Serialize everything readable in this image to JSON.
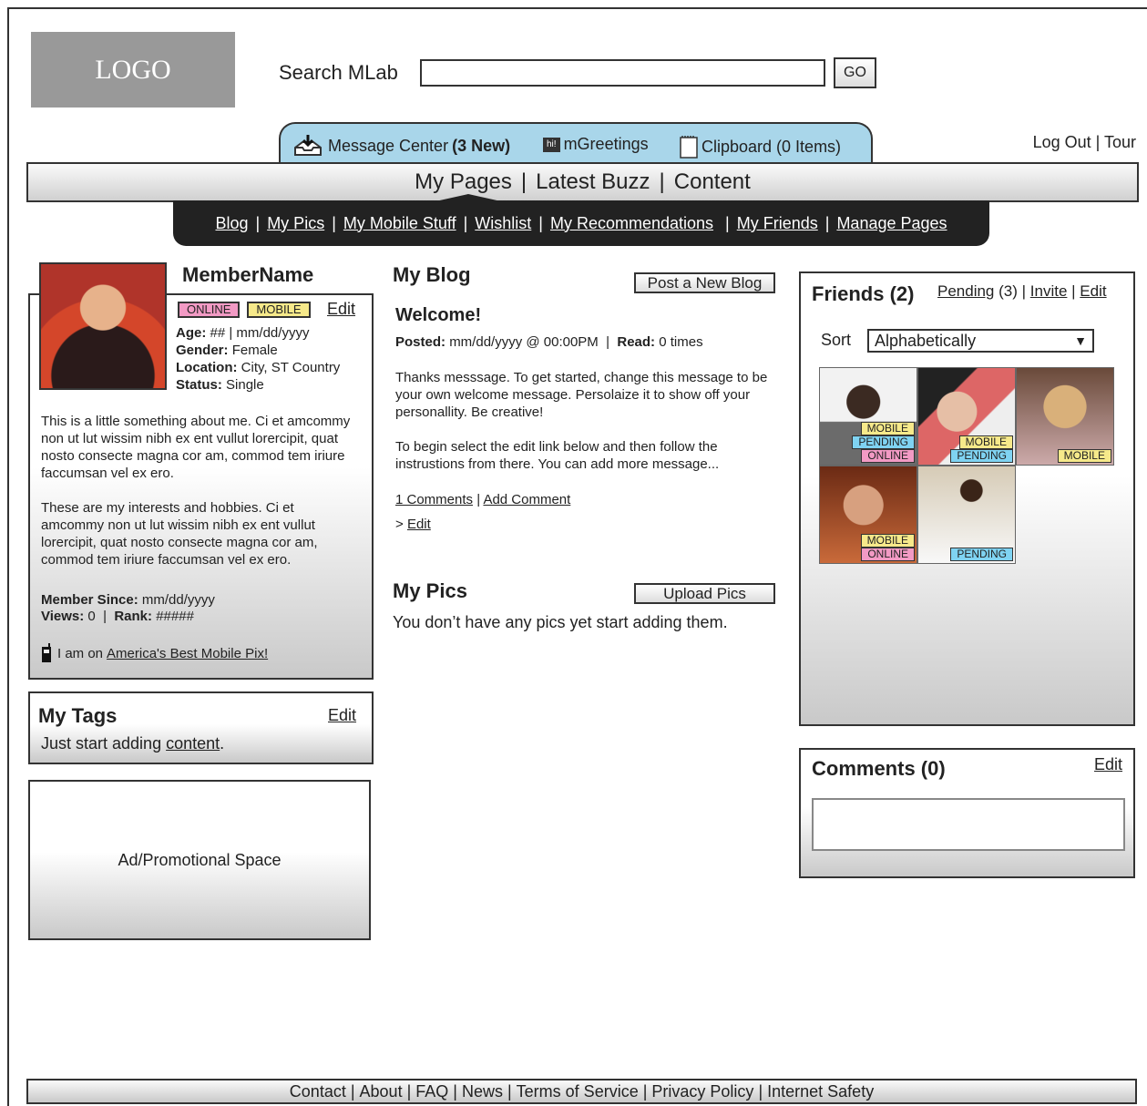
{
  "header": {
    "logo": "LOGO",
    "search_label": "Search MLab",
    "search_value": "",
    "go": "GO"
  },
  "utility": {
    "message_center": "Message Center",
    "message_new": "(3 New)",
    "mgreetings": "mGreetings",
    "mgreetings_icon_text": "hi!",
    "clipboard": "Clipboard (0 Items)",
    "logout": "Log Out",
    "tour": "Tour"
  },
  "mainnav": {
    "items": [
      "My Pages",
      "Latest Buzz",
      "Content"
    ]
  },
  "subnav": {
    "items": [
      "Blog",
      "My Pics",
      "My Mobile Stuff",
      "Wishlist",
      "My Recommendations",
      "My Friends",
      "Manage Pages"
    ]
  },
  "profile": {
    "name": "MemberName",
    "online": "ONLINE",
    "mobile": "MOBILE",
    "edit": "Edit",
    "age_label": "Age:",
    "age_value": "## | mm/dd/yyyy",
    "gender_label": "Gender:",
    "gender_value": "Female",
    "location_label": "Location:",
    "location_value": "City, ST Country",
    "status_label": "Status:",
    "status_value": "Single",
    "about1": "This is a little something about me. Ci et amcommy non ut lut wissim nibh ex ent vullut lorercipit, quat nosto consecte magna cor am, commod tem iriure faccumsan vel ex ero.",
    "about2": "These are my interests and hobbies. Ci et amcommy non ut lut wissim nibh ex ent vullut lorercipit, quat nosto consecte magna cor am, commod tem iriure faccumsan vel ex ero.",
    "member_since_label": "Member Since:",
    "member_since_value": "mm/dd/yyyy",
    "views_label": "Views:",
    "views_value": "0",
    "rank_label": "Rank:",
    "rank_value": "#####",
    "mobile_note": "I am on",
    "mobile_link": "America's Best Mobile Pix!"
  },
  "tags": {
    "title": "My Tags",
    "edit": "Edit",
    "text": "Just start adding",
    "link": "content",
    "period": "."
  },
  "ad": {
    "text": "Ad/Promotional Space"
  },
  "blog": {
    "title": "My Blog",
    "post_button": "Post a New Blog",
    "post_title": "Welcome!",
    "posted_label": "Posted:",
    "posted_value": "mm/dd/yyyy @ 00:00PM",
    "read_label": "Read:",
    "read_value": "0 times",
    "para1": "Thanks messsage. To get started, change this message to be your own welcome message. Persolaize it to show off your personallity. Be creative!",
    "para2": "To begin select the edit link below and then follow the instrustions from there. You can add more message...",
    "comments_link": "1 Comments",
    "add_comment": "Add Comment",
    "edit_prefix": ">",
    "edit": "Edit"
  },
  "pics": {
    "title": "My Pics",
    "upload_button": "Upload Pics",
    "empty_text": "You don’t have any pics yet start adding them."
  },
  "friends": {
    "title": "Friends (2)",
    "pending_link": "Pending",
    "pending_count": "(3)",
    "invite": "Invite",
    "edit": "Edit",
    "sort_label": "Sort",
    "sort_value": "Alphabetically",
    "list": [
      {
        "badges": [
          "MOBILE",
          "PENDING",
          "ONLINE"
        ]
      },
      {
        "badges": [
          "MOBILE",
          "PENDING"
        ]
      },
      {
        "badges": [
          "MOBILE"
        ]
      },
      {
        "badges": [
          "MOBILE",
          "ONLINE"
        ]
      },
      {
        "badges": [
          "PENDING"
        ]
      }
    ]
  },
  "comments": {
    "title": "Comments (0)",
    "edit": "Edit"
  },
  "footer": {
    "items": [
      "Contact",
      "About",
      "FAQ",
      "News",
      "Terms of Service",
      "Privacy Policy",
      "Internet Safety"
    ]
  }
}
